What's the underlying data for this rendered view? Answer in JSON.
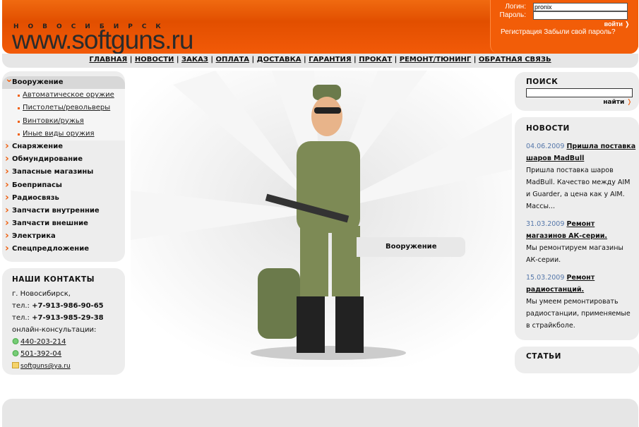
{
  "header": {
    "city": "НОВОСИБИРСК",
    "logo": "www.softguns.ru"
  },
  "login": {
    "login_label": "Логин:",
    "login_value": "pronix",
    "password_label": "Пароль:",
    "password_value": "",
    "enter": "войти ❭",
    "register": "Регистрация",
    "forgot": "Забыли свой пароль?"
  },
  "nav": [
    "ГЛАВНАЯ",
    "НОВОСТИ",
    "ЗАКАЗ",
    "ОПЛАТА",
    "ДОСТАВКА",
    "ГАРАНТИЯ",
    "ПРОКАТ",
    "РЕМОНТ/ТЮНИНГ",
    "ОБРАТНАЯ СВЯЗЬ"
  ],
  "menu": {
    "open": "Вооружение",
    "subs": [
      "Автоматическое оружие",
      "Пистолеты/револьверы",
      "Винтовки/ружья",
      "Иные виды оружия"
    ],
    "items": [
      "Снаряжение",
      "Обмундирование",
      "Запасные магазины",
      "Боеприпасы",
      "Радиосвязь",
      "Запчасти внутренние",
      "Запчасти внешние",
      "Электрика",
      "Спецпредложение"
    ]
  },
  "contacts": {
    "title": "НАШИ КОНТАКТЫ",
    "city": "г. Новосибирск,",
    "tel_label": "тел.:",
    "tel1": "+7-913-986-90-65",
    "tel2": "+7-913-985-29-38",
    "online": "онлайн-консультации:",
    "icq1": "440-203-214",
    "icq2": "501-392-04",
    "email": "softguns@ya.ru"
  },
  "center": {
    "caption": "Вооружение"
  },
  "search": {
    "title": "ПОИСК",
    "value": "",
    "button": "найти"
  },
  "news": {
    "title": "НОВОСТИ",
    "items": [
      {
        "date": "04.06.2009",
        "title": "Пришла поставка шаров MadBull",
        "text": "Пришла поставка шаров MadBull. Качество между AIM и Guarder, а цена как у AIM.",
        "more": "Массы..."
      },
      {
        "date": "31.03.2009",
        "title": "Ремонт магазинов АК-серии.",
        "text": "Мы ремонтируем магазины АК-серии."
      },
      {
        "date": "15.03.2009",
        "title": "Ремонт радиостанций.",
        "text": "Мы умеем ремонтировать радиостанции, применяемые в страйкболе."
      }
    ]
  },
  "articles": {
    "title": "СТАТЬИ"
  },
  "colors": {
    "accent": "#f06010",
    "panel": "#ededed",
    "date": "#5577aa"
  }
}
